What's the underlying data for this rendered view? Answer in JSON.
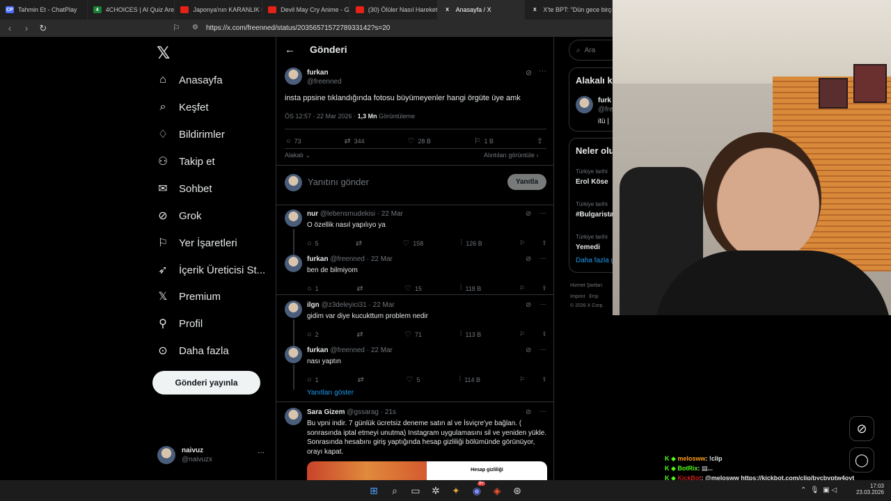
{
  "browser": {
    "tabs": [
      {
        "title": "Tahmin Et - ChatPlay",
        "icon": "chatplay-icon",
        "badge": "CP",
        "color": "#4a6cff"
      },
      {
        "title": "4CHOICES | AI Quiz Arena",
        "icon": "quiz-icon",
        "badge": "4",
        "color": "#1a7f37"
      },
      {
        "title": "Japonya'nın KARANLIK Ge",
        "icon": "youtube-icon",
        "badge": "",
        "color": "#e62117"
      },
      {
        "title": "Devil May Cry Anime - Gö",
        "icon": "youtube-icon",
        "badge": "",
        "color": "#e62117"
      },
      {
        "title": "(30) Ölüler Nasıl Hareket E",
        "icon": "youtube-icon",
        "badge": "",
        "color": "#e62117"
      },
      {
        "title": "Anasayfa / X",
        "icon": "x-icon",
        "badge": "X",
        "color": "#000000"
      },
      {
        "title": "X'te BPT: \"Dün gece birço",
        "icon": "x-icon",
        "badge": "X",
        "color": "#000000"
      }
    ],
    "url": "https://x.com/freenned/status/2035657157278933142?s=20"
  },
  "sidebar": {
    "items": [
      {
        "label": "Anasayfa",
        "icon": "home-icon",
        "glyph": "⌂"
      },
      {
        "label": "Keşfet",
        "icon": "search-icon",
        "glyph": "⌕"
      },
      {
        "label": "Bildirimler",
        "icon": "bell-icon",
        "glyph": "♢"
      },
      {
        "label": "Takip et",
        "icon": "add-user-icon",
        "glyph": "⚇"
      },
      {
        "label": "Sohbet",
        "icon": "mail-icon",
        "glyph": "✉"
      },
      {
        "label": "Grok",
        "icon": "grok-icon",
        "glyph": "⊘"
      },
      {
        "label": "Yer İşaretleri",
        "icon": "bookmark-icon",
        "glyph": "⚐"
      },
      {
        "label": "İçerik Üreticisi St...",
        "icon": "rocket-icon",
        "glyph": "➶"
      },
      {
        "label": "Premium",
        "icon": "x-premium-icon",
        "glyph": "𝕏"
      },
      {
        "label": "Profil",
        "icon": "profile-icon",
        "glyph": "⚲"
      },
      {
        "label": "Daha fazla",
        "icon": "more-circle-icon",
        "glyph": "⊙"
      }
    ],
    "post_button": "Gönderi yayınla",
    "me": {
      "name": "naivuz",
      "handle": "@naivuzx",
      "more": "···"
    }
  },
  "main": {
    "title": "Gönderi",
    "post": {
      "name": "furkan",
      "handle": "@freenned",
      "text": "insta ppsine tıklandığında fotosu büyümeyenler hangi örgüte üye amk",
      "time": "ÖS 12:57 · 22 Mar 2026 ·",
      "views": "1,3 Mn",
      "views_label": "Görüntüleme",
      "replies": "73",
      "reposts": "344",
      "likes": "28 B",
      "bookmarks": "1 B"
    },
    "sort_label": "Alakalı",
    "quotes_link": "Alıntıları görüntüle",
    "reply_placeholder": "Yanıtını gönder",
    "reply_button": "Yanıtla",
    "replies": [
      {
        "name": "nur",
        "handle": "@lebensmudekisi",
        "date": "· 22 Mar",
        "text": "O özellik nasıl yapılıyo ya",
        "replies": "5",
        "reposts": "",
        "likes": "158",
        "views": "126 B"
      },
      {
        "name": "furkan",
        "handle": "@freenned",
        "date": "· 22 Mar",
        "text": "ben de bilmiyom",
        "replies": "1",
        "reposts": "",
        "likes": "15",
        "views": "118 B"
      },
      {
        "name": "ilgn",
        "handle": "@z3deleyici31",
        "date": "· 22 Mar",
        "text": "gidim var diye kucukttum problem nedir",
        "replies": "2",
        "reposts": "",
        "likes": "71",
        "views": "113 B"
      },
      {
        "name": "furkan",
        "handle": "@freenned",
        "date": "· 22 Mar",
        "text": "nası yaptın",
        "replies": "1",
        "reposts": "",
        "likes": "5",
        "views": "114 B"
      }
    ],
    "show_replies": "Yanıtları göster",
    "last_reply": {
      "name": "Sara Gizem",
      "handle": "@gssarag",
      "date": "· 21s",
      "text": "Bu vpni indir. 7 günlük ücretsiz deneme satın al ve İsviçre'ye bağlan. ( sonrasında iptal etmeyi unutma) Instagram uygulamasını sil ve yeniden yükle. Sonrasında hesabını giriş yaptığında hesap gizliliği bölümünde görünüyor, orayı kapat.",
      "image_caption": "Hesap gizliliği"
    }
  },
  "right": {
    "search_placeholder": "Ara",
    "related_title": "Alakalı k",
    "related_user": {
      "name": "furk",
      "handle": "@fre",
      "bio": "itü | "
    },
    "trending_title": "Neler olu",
    "trends": [
      {
        "context": "Türkiye tarihi",
        "topic": "Erol Köse"
      },
      {
        "context": "Türkiye tarihi",
        "topic": "#Bulgarista"
      },
      {
        "context": "Türkiye tarihi",
        "topic": "Yemedi"
      }
    ],
    "more_link": "Daha fazla g",
    "footer": [
      "Hizmet Şartları",
      "Imprint",
      "Erişi",
      "© 2026 X Corp."
    ]
  },
  "chat": [
    {
      "user": "melosww",
      "message": ": !clip",
      "user_color": "#ff9f1a"
    },
    {
      "user": "BotRix",
      "message": ": ▤...",
      "user_color": "#53fc18"
    },
    {
      "user": "KickBot",
      "message": ": @melosww https://kickbot.com/clip/bycbvptw4oyt",
      "user_color": "#c81e1e"
    }
  ],
  "taskbar": {
    "time": "17:03",
    "date": "23.03.2026",
    "discord_badge": "9+"
  }
}
